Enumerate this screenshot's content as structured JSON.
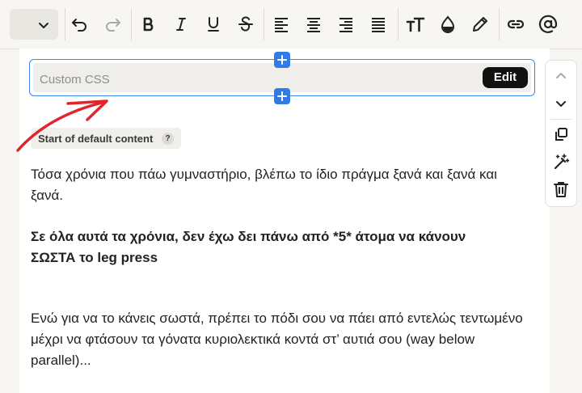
{
  "toolbar": {
    "items": [
      {
        "name": "block-type-select",
        "icon": "chevron-down-icon"
      },
      {
        "name": "undo-button",
        "icon": "undo-icon"
      },
      {
        "name": "redo-button",
        "icon": "redo-icon"
      },
      {
        "name": "bold-button",
        "icon": "bold-icon"
      },
      {
        "name": "italic-button",
        "icon": "italic-icon"
      },
      {
        "name": "underline-button",
        "icon": "underline-icon"
      },
      {
        "name": "strikethrough-button",
        "icon": "strikethrough-icon"
      },
      {
        "name": "align-left-button",
        "icon": "align-left-icon"
      },
      {
        "name": "align-center-button",
        "icon": "align-center-icon"
      },
      {
        "name": "align-right-button",
        "icon": "align-right-icon"
      },
      {
        "name": "align-justify-button",
        "icon": "align-justify-icon"
      },
      {
        "name": "text-size-button",
        "icon": "text-size-icon"
      },
      {
        "name": "text-color-button",
        "icon": "droplet-icon"
      },
      {
        "name": "highlight-button",
        "icon": "pen-icon"
      },
      {
        "name": "link-button",
        "icon": "link-icon"
      },
      {
        "name": "mention-button",
        "icon": "at-icon"
      }
    ]
  },
  "css_block": {
    "label": "Custom CSS",
    "edit_label": "Edit",
    "add_icon": "plus-icon"
  },
  "side_tools": [
    {
      "name": "move-up-button",
      "icon": "chevron-up-icon"
    },
    {
      "name": "move-down-button",
      "icon": "chevron-down-icon"
    },
    {
      "name": "duplicate-button",
      "icon": "copy-icon"
    },
    {
      "name": "ai-magic-button",
      "icon": "magic-wand-icon"
    },
    {
      "name": "delete-button",
      "icon": "trash-icon"
    }
  ],
  "content": {
    "default_tag": "Start of default content",
    "help": "?",
    "paragraph1": "Τόσα χρόνια που πάω γυμναστήριο, βλέπω το ίδιο πράγμα ξανά και ξανά και ξανά.",
    "paragraph2_line1": "Σε όλα αυτά τα χρόνια, δεν έχω δει πάνω από *5* άτομα να κάνουν",
    "paragraph2_line2": "ΣΩΣΤΑ το leg press",
    "paragraph3_line1": "Ενώ για να το κάνεις σωστά, πρέπει το πόδι σου να πάει από εντελώς τεντωμένο",
    "paragraph3_line2": "μέχρι να φτάσουν τα γόνατα κυριολεκτικά κοντά στ’ αυτιά σου (way below",
    "paragraph3_line3": "parallel)..."
  },
  "colors": {
    "accent": "#2f7ce6",
    "annotation_arrow": "#e0252b",
    "edit_button": "#111111"
  }
}
